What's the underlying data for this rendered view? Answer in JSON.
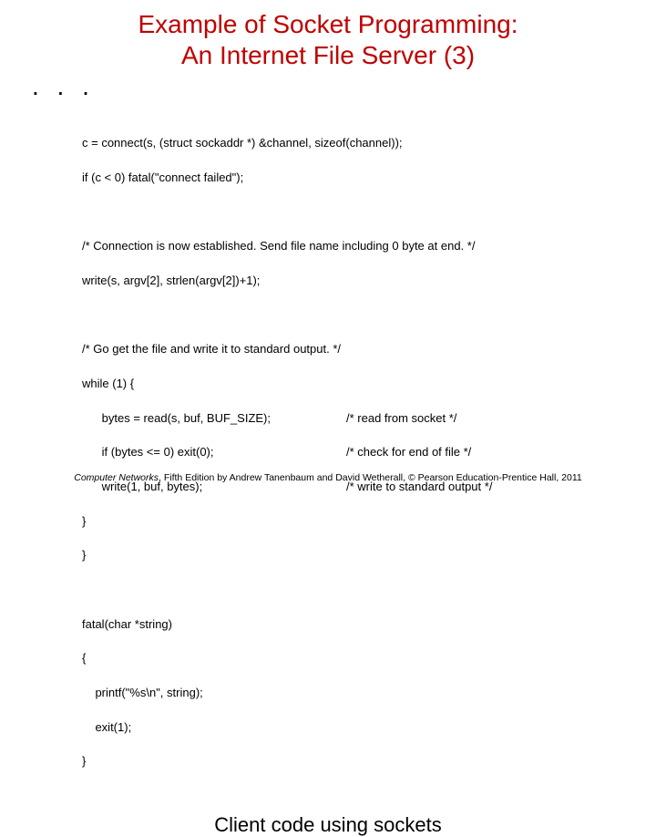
{
  "title_line1": "Example of Socket Programming:",
  "title_line2": "An Internet File Server (3)",
  "ellipsis": ". . .",
  "code": {
    "l1": "c = connect(s, (struct sockaddr *) &channel, sizeof(channel));",
    "l2": "if (c < 0) fatal(\"connect failed\");",
    "blank1": "",
    "l3": "/* Connection is now established. Send file name including 0 byte at end. */",
    "l4": "write(s, argv[2], strlen(argv[2])+1);",
    "blank2": "",
    "l5": "/* Go get the file and write it to standard output. */",
    "l6": "while (1) {",
    "l7a": "      bytes = read(s, buf, BUF_SIZE);",
    "l7b": "/* read from socket */",
    "l8a": "      if (bytes <= 0) exit(0);",
    "l8b": "/* check for end of file */",
    "l9a": "      write(1, buf, bytes);",
    "l9b": "/* write to standard output */",
    "l10": "}",
    "l11": "}",
    "blank3": "",
    "l12": "fatal(char *string)",
    "l13": "{",
    "l14": "    printf(\"%s\\n\", string);",
    "l15": "    exit(1);",
    "l16": "}"
  },
  "caption": "Client code using sockets",
  "footer_book": "Computer Networks",
  "footer_rest": ", Fifth Edition by Andrew Tanenbaum and David Wetherall, © Pearson Education-Prentice Hall, 2011"
}
